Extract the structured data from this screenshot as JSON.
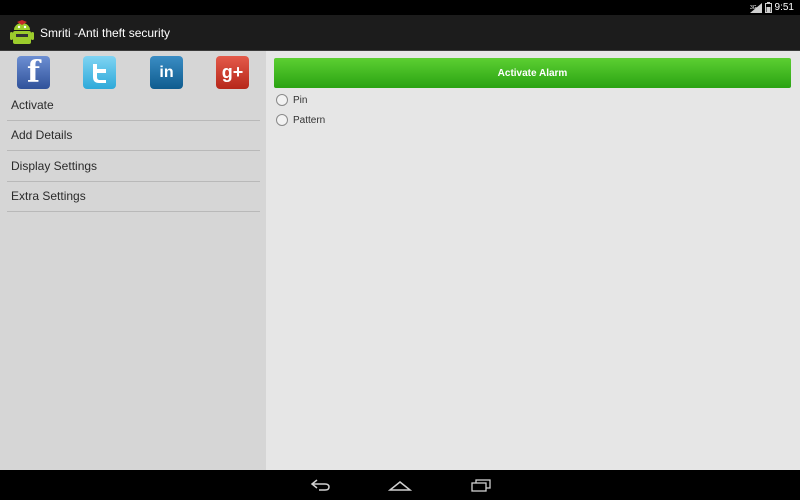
{
  "status_bar": {
    "time": "9:51",
    "signal_label": "3G"
  },
  "action_bar": {
    "title": "Smriti -Anti theft security"
  },
  "sidebar": {
    "social": [
      {
        "name": "facebook",
        "glyph": "f",
        "color": "#3b5998"
      },
      {
        "name": "twitter",
        "glyph": "t",
        "color": "#33b5e5"
      },
      {
        "name": "linkedin",
        "glyph": "in",
        "color": "#0e76a8"
      },
      {
        "name": "google-plus",
        "glyph": "g+",
        "color": "#d34836"
      }
    ],
    "items": [
      {
        "label": "Activate"
      },
      {
        "label": "Add Details"
      },
      {
        "label": "Display Settings"
      },
      {
        "label": "Extra Settings"
      }
    ]
  },
  "main": {
    "activate_button": "Activate Alarm",
    "options": [
      {
        "label": "Pin",
        "checked": false
      },
      {
        "label": "Pattern",
        "checked": false
      }
    ]
  },
  "colors": {
    "accent_green": "#3db81e",
    "sidebar_bg": "#d6d6d6",
    "content_bg": "#e6e6e6"
  }
}
